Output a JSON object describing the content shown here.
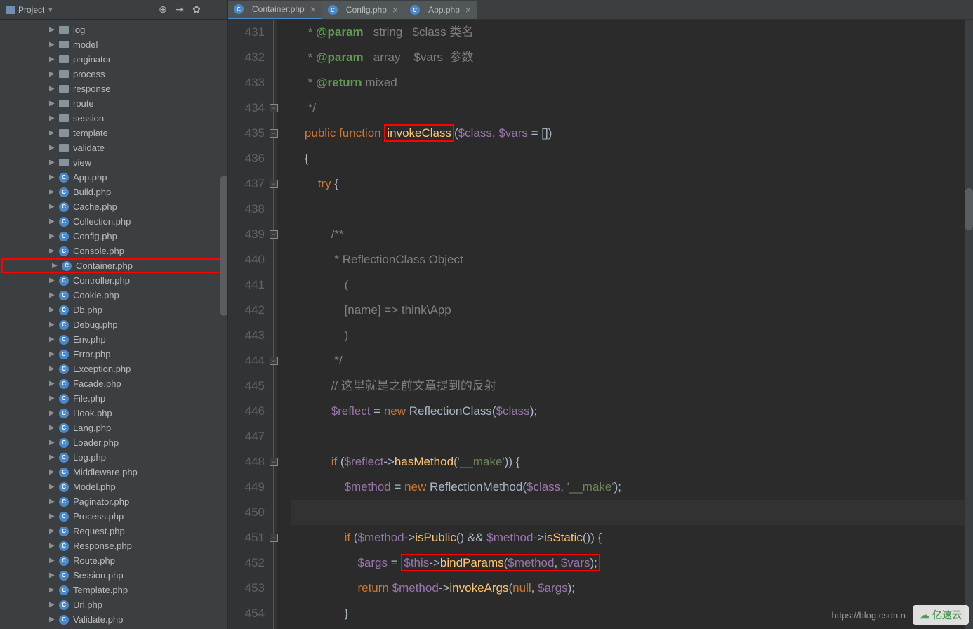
{
  "sidebar": {
    "title": "Project",
    "folders": [
      "log",
      "model",
      "paginator",
      "process",
      "response",
      "route",
      "session",
      "template",
      "validate",
      "view"
    ],
    "files": [
      "App.php",
      "Build.php",
      "Cache.php",
      "Collection.php",
      "Config.php",
      "Console.php",
      "Container.php",
      "Controller.php",
      "Cookie.php",
      "Db.php",
      "Debug.php",
      "Env.php",
      "Error.php",
      "Exception.php",
      "Facade.php",
      "File.php",
      "Hook.php",
      "Lang.php",
      "Loader.php",
      "Log.php",
      "Middleware.php",
      "Model.php",
      "Paginator.php",
      "Process.php",
      "Request.php",
      "Response.php",
      "Route.php",
      "Session.php",
      "Template.php",
      "Url.php",
      "Validate.php"
    ],
    "selected_file": "Container.php"
  },
  "tabs": [
    {
      "label": "Container.php",
      "active": true
    },
    {
      "label": "Config.php",
      "active": false
    },
    {
      "label": "App.php",
      "active": false
    }
  ],
  "line_numbers": [
    431,
    432,
    433,
    434,
    435,
    436,
    437,
    438,
    439,
    440,
    441,
    442,
    443,
    444,
    445,
    446,
    447,
    448,
    449,
    450,
    451,
    452,
    453,
    454
  ],
  "code": {
    "l431": {
      "pre": "     * ",
      "tag": "@param",
      "sp": "   ",
      "type": "string",
      "sp2": "   ",
      "var": "$class",
      "cn": " 类名"
    },
    "l432": {
      "pre": "     * ",
      "tag": "@param",
      "sp": "   ",
      "type": "array",
      "sp2": "    ",
      "var": "$vars",
      "cn": "  参数"
    },
    "l433": {
      "pre": "     * ",
      "tag": "@return",
      "sp": " ",
      "type": "mixed"
    },
    "l434": {
      "pre": "     */"
    },
    "l435": {
      "pub": "public",
      "fn": "function",
      "name": "invokeClass",
      "sig_open": "(",
      "p1": "$class",
      "c": ", ",
      "p2": "$vars",
      "eq": " = []",
      "sig_close": ")"
    },
    "l436": {
      "brace": "{"
    },
    "l437": {
      "kw": "try",
      "br": " {"
    },
    "l439": {
      "c": "/**"
    },
    "l440": {
      "c": " * ReflectionClass Object"
    },
    "l441": {
      "c": "    ("
    },
    "l442": {
      "c": "    [name] => think\\App"
    },
    "l443": {
      "c": "    )"
    },
    "l444": {
      "c": " */"
    },
    "l445": {
      "c": "// 这里就是之前文章提到的反射"
    },
    "l446": {
      "var": "$reflect",
      "eq": " = ",
      "kw": "new",
      "cls": " ReflectionClass(",
      "p": "$class",
      "end": ");"
    },
    "l448": {
      "kw": "if",
      "o": " (",
      "v": "$reflect",
      "arr": "->",
      "m": "hasMethod",
      "o2": "(",
      "s": "'__make'",
      "o3": ")) {"
    },
    "l449": {
      "v": "$method",
      "eq": " = ",
      "kw": "new",
      "cls": " ReflectionMethod(",
      "p1": "$class",
      "c": ", ",
      "s": "'__make'",
      "end": ");"
    },
    "l451": {
      "kw": "if",
      "o": " (",
      "v": "$method",
      "arr": "->",
      "m": "isPublic",
      "o2": "() && ",
      "v2": "$method",
      "arr2": "->",
      "m2": "isStatic",
      "o3": "()) {"
    },
    "l452": {
      "v": "$args",
      "eq": " = ",
      "v2": "$this",
      "arr": "->",
      "m": "bindParams",
      "o": "(",
      "p1": "$method",
      "c": ", ",
      "p2": "$vars",
      "end": ");"
    },
    "l453": {
      "kw": "return",
      "sp": " ",
      "v": "$method",
      "arr": "->",
      "m": "invokeArgs",
      "o": "(",
      "n": "null",
      "c": ", ",
      "p": "$args",
      "end": ");"
    },
    "l454": {
      "brace": "}"
    }
  },
  "watermark": {
    "url": "https://blog.csdn.n",
    "brand": "亿速云"
  }
}
